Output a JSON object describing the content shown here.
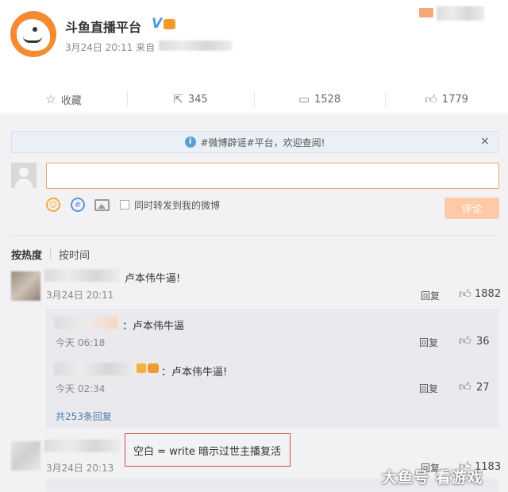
{
  "post": {
    "author": "斗鱼直播平台",
    "verified_mark": "V",
    "time": "3月24日 20:11",
    "source_prefix": "来自"
  },
  "actions": {
    "favorite": "收藏",
    "repost_count": "345",
    "comment_count": "1528",
    "like_count": "1779"
  },
  "notice": {
    "text": "#微博辟谣#平台，欢迎查阅!",
    "info_glyph": "i",
    "close_glyph": "×"
  },
  "composer": {
    "value": "",
    "forward_label": "同时转发到我的微博",
    "submit_label": "评论"
  },
  "sort": {
    "hot": "按热度",
    "time": "按时间"
  },
  "comments": [
    {
      "text": "卢本伟牛逼!",
      "time": "3月24日 20:11",
      "reply_label": "回复",
      "likes": "1882",
      "replies": [
        {
          "text": "：卢本伟牛逼",
          "time": "今天 06:18",
          "reply_label": "回复",
          "likes": "36"
        },
        {
          "text": "：卢本伟牛逼!",
          "time": "今天 02:34",
          "reply_label": "回复",
          "likes": "27"
        }
      ],
      "total_replies": "共253条回复"
    },
    {
      "time": "3月24日 20:13",
      "reply_label": "回复",
      "likes": "1183"
    }
  ],
  "annotation": {
    "text": "空白 = write 暗示过世主播复活",
    "color": "#d24b4b"
  },
  "watermark": "大鱼号 看游戏",
  "colors": {
    "accent_orange": "#f38b33",
    "link_blue": "#4a7ba8",
    "verified_blue": "#4a9bd7"
  }
}
